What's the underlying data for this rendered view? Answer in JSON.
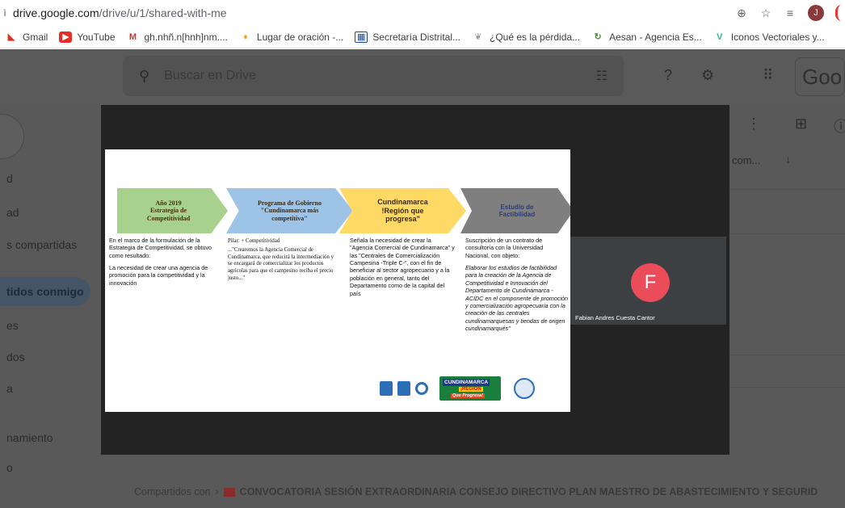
{
  "browser": {
    "url_host": "drive.google.com",
    "url_path": "/drive/u/1/shared-with-me",
    "avatar_initial": "J",
    "bookmarks": [
      {
        "label": "Gmail",
        "icon": "gmail-icon"
      },
      {
        "label": "YouTube",
        "icon": "youtube-icon"
      },
      {
        "label": "gh.nhñ.n[hnh]nm....",
        "icon": "gmail-m-icon"
      },
      {
        "label": "Lugar de oración -...",
        "icon": "flame-icon"
      },
      {
        "label": "Secretaría Distrital...",
        "icon": "seal-icon"
      },
      {
        "label": "¿Qué es la pérdida...",
        "icon": "leaf-icon"
      },
      {
        "label": "Aesan - Agencia Es...",
        "icon": "circle-arrow-icon"
      },
      {
        "label": "Iconos Vectoriales y...",
        "icon": "vector-v-icon"
      }
    ]
  },
  "drive": {
    "search_placeholder": "Buscar en Drive",
    "brand_partial": "Goo",
    "sidebar": [
      {
        "label": "d"
      },
      {
        "label": "ad"
      },
      {
        "label": "s compartidas"
      },
      {
        "label": "tidos conmigo",
        "active": true
      },
      {
        "label": "es"
      },
      {
        "label": "dos"
      },
      {
        "label": "a"
      },
      {
        "label": "namiento"
      },
      {
        "label": "o"
      }
    ],
    "list_header_partial": "com...",
    "breadcrumb_prefix": "Compartidos con",
    "breadcrumb_title": "CONVOCATORIA SESIÓN EXTRAORDINARIA CONSEJO DIRECTIVO PLAN MAESTRO DE ABASTECIMIENTO Y SEGURID"
  },
  "call": {
    "participant_initial": "F",
    "participant_name": "Fabian Andres Cuesta Cantor",
    "avatar_color": "#ea4c59"
  },
  "slide": {
    "steps": [
      {
        "title": "Año 2019\nEstrategia de\nCompetitividad",
        "color": "#a9d18e"
      },
      {
        "title": "Programa de Gobierno\n\"Cundinamarca más\ncompetitiva\"",
        "color": "#9dc3e6"
      },
      {
        "title": "Cundinamarca\n!Región que\nprogresa\"",
        "color": "#ffd966"
      },
      {
        "title": "Estudio de\nFactibilidad",
        "color": "#7f7f7f"
      }
    ],
    "col1_p1": "En el marco de la formulación de la Estrategia de Competitividad, se obtuvo como resultado:",
    "col1_p2": "La necesidad de crear una agencia de promoción para la competitividad y la innovación",
    "col2_p1": "Pilar: + Competitividad",
    "col2_p2": "...\"Crearemos la Agencia Comercial de Cundinamarca, que reducirá la intermediación y se encargará de comercializar los productos agrícolas para que el campesino reciba el precio justo...\"",
    "col3_p1": "Señala la necesidad de crear la \"Agencia Comercial de Cundinamarca\" y las \"Centrales de Comercialización Campesina -Triple C-\", con el fin de beneficiar al sector agropecuario y a la población en general, tanto del Departamento como de la capital del país",
    "col4_p1": "Suscripción de un contrato de consultoría con la Universidad Nacional, con objeto:",
    "col4_p2": "Elaborar los estudios de factibilidad para la creación de la Agencia de Competitividad e Innovación del Departamento de Cundinamarca - ACIDC en el componente de promoción y comercialización agropecuaria con la creación de las centrales cundinamarquesas y tiendas de origen cundinamarqués\"",
    "logo_top": "CUNDINAMARCA",
    "logo_mid": "¡REGIÓN",
    "logo_bot": "Que Progresa!"
  }
}
